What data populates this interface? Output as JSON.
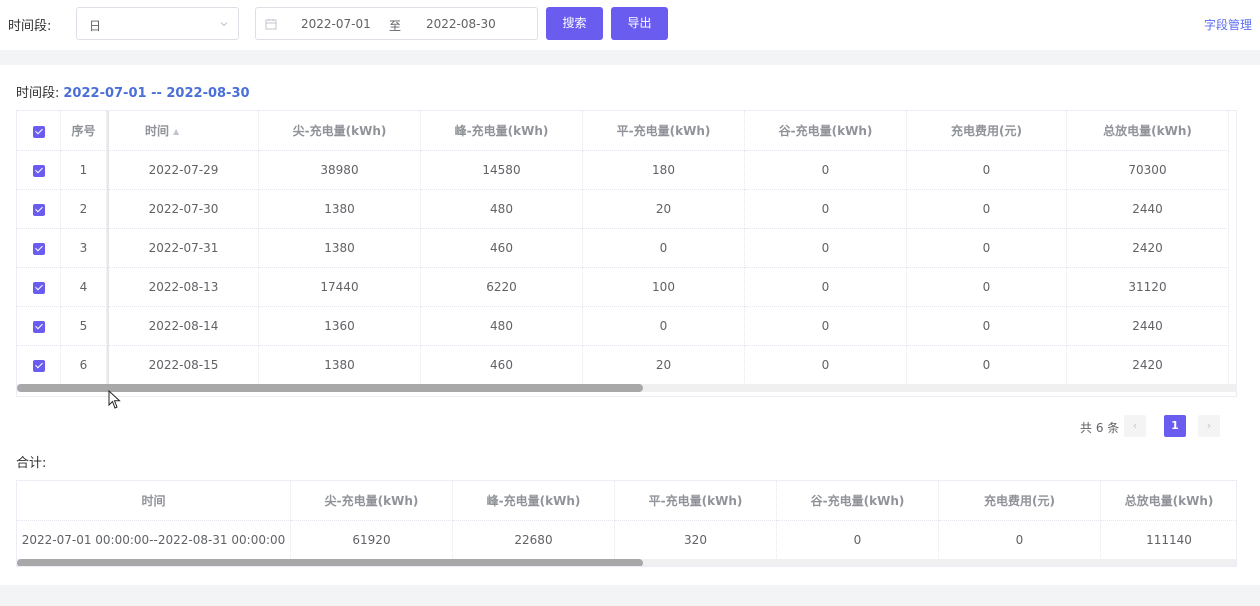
{
  "toolbar": {
    "period_label": "时间段:",
    "period_select": "日",
    "date_start": "2022-07-01",
    "date_sep": "至",
    "date_end": "2022-08-30",
    "search_label": "搜索",
    "export_label": "导出",
    "field_mgmt": "字段管理"
  },
  "range": {
    "label": "时间段:",
    "dates": "2022-07-01 -- 2022-08-30"
  },
  "main_table": {
    "headers": [
      "序号",
      "时间",
      "尖-充电量(kWh)",
      "峰-充电量(kWh)",
      "平-充电量(kWh)",
      "谷-充电量(kWh)",
      "充电费用(元)",
      "总放电量(kWh)"
    ],
    "rows": [
      [
        "1",
        "2022-07-29",
        "38980",
        "14580",
        "180",
        "0",
        "0",
        "70300"
      ],
      [
        "2",
        "2022-07-30",
        "1380",
        "480",
        "20",
        "0",
        "0",
        "2440"
      ],
      [
        "3",
        "2022-07-31",
        "1380",
        "460",
        "0",
        "0",
        "0",
        "2420"
      ],
      [
        "4",
        "2022-08-13",
        "17440",
        "6220",
        "100",
        "0",
        "0",
        "31120"
      ],
      [
        "5",
        "2022-08-14",
        "1360",
        "480",
        "0",
        "0",
        "0",
        "2440"
      ],
      [
        "6",
        "2022-08-15",
        "1380",
        "460",
        "20",
        "0",
        "0",
        "2420"
      ]
    ]
  },
  "pagination": {
    "total": "共 6 条",
    "current": "1",
    "prev": "‹",
    "next": "›"
  },
  "summary": {
    "label": "合计:",
    "headers": [
      "时间",
      "尖-充电量(kWh)",
      "峰-充电量(kWh)",
      "平-充电量(kWh)",
      "谷-充电量(kWh)",
      "充电费用(元)",
      "总放电量(kWh)"
    ],
    "row": [
      "2022-07-01 00:00:00--2022-08-31 00:00:00",
      "61920",
      "22680",
      "320",
      "0",
      "0",
      "111140"
    ]
  },
  "colors": {
    "accent": "#6b5cf0",
    "link": "#5b6cf0",
    "date_highlight": "#4a6fd8"
  }
}
